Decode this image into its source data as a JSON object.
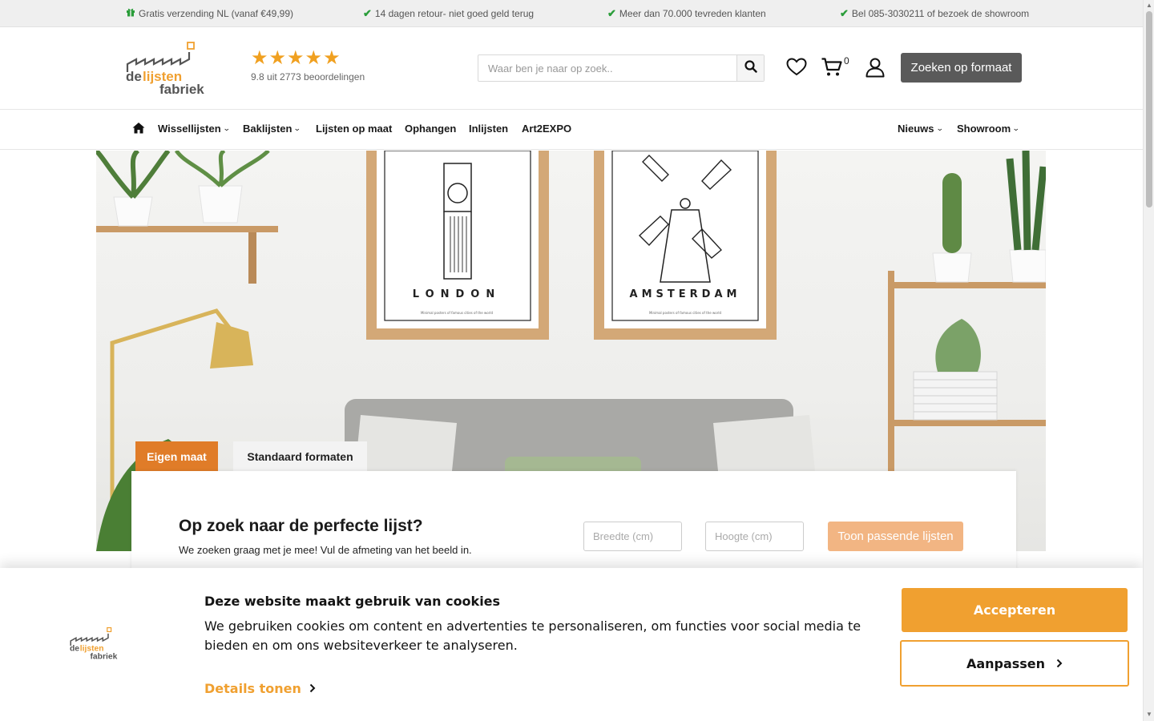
{
  "usp_bar": {
    "items": [
      {
        "icon": "gift-icon",
        "text": "Gratis verzending NL (vanaf €49,99)"
      },
      {
        "icon": "check-icon",
        "text": "14 dagen retour- niet goed geld terug"
      },
      {
        "icon": "check-icon",
        "text": "Meer dan 70.000 tevreden klanten"
      },
      {
        "icon": "check-icon",
        "text": "Bel 085-3030211 of bezoek de showroom"
      }
    ]
  },
  "header": {
    "logo": {
      "line1_a": "de",
      "line1_b": "lijsten",
      "line2": "fabriek"
    },
    "rating": {
      "stars": "★★★★★",
      "score": 5,
      "text": "9.8 uit 2773 beoordelingen"
    },
    "search": {
      "placeholder": "Waar ben je naar op zoek.."
    },
    "cart_count": "0",
    "format_button": "Zoeken op formaat"
  },
  "nav": {
    "items": [
      {
        "label": "Wissellijsten",
        "dropdown": true
      },
      {
        "label": "Baklijsten",
        "dropdown": true
      },
      {
        "label": "Lijsten op maat",
        "dropdown": false
      },
      {
        "label": "Ophangen",
        "dropdown": false
      },
      {
        "label": "Inlijsten",
        "dropdown": false
      },
      {
        "label": "Art2EXPO",
        "dropdown": false
      },
      {
        "label": "Nieuws",
        "dropdown": true
      },
      {
        "label": "Showroom",
        "dropdown": true
      }
    ]
  },
  "hero": {
    "poster_left": {
      "title": "LONDON",
      "caption": "Minimal posters of famous cities of the world"
    },
    "poster_right": {
      "title": "AMSTERDAM",
      "caption": "Minimal posters of famous cities of the world"
    }
  },
  "finder": {
    "tabs": [
      {
        "label": "Eigen maat",
        "active": true
      },
      {
        "label": "Standaard formaten",
        "active": false
      }
    ],
    "title": "Op zoek naar de perfecte lijst?",
    "subtitle": "We zoeken graag met je mee! Vul de afmeting van het beeld in.",
    "width_placeholder": "Breedte (cm)",
    "height_placeholder": "Hoogte (cm)",
    "button": "Toon passende lijsten"
  },
  "cookie_banner": {
    "title": "Deze website maakt gebruik van cookies",
    "text": "We gebruiken cookies om content en advertenties te personaliseren, om functies voor social media te bieden en om ons websiteverkeer te analyseren.",
    "details_link": "Details tonen",
    "accept_button": "Accepteren",
    "adjust_button": "Aanpassen"
  },
  "colors": {
    "accent_orange": "#e07c28",
    "cookie_orange": "#f0a030",
    "star_color": "#f0a020",
    "check_green": "#2a9d3a",
    "button_dark": "#5a5a5a"
  }
}
